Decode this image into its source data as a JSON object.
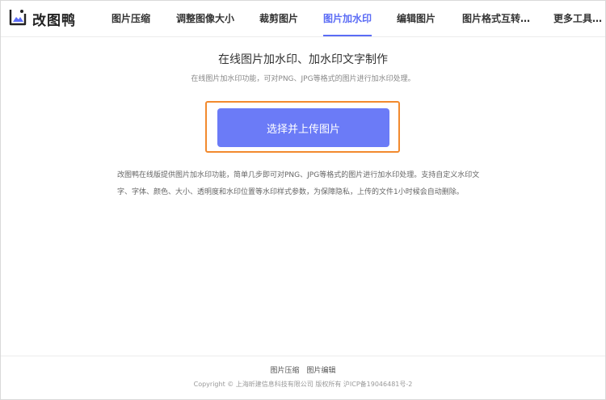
{
  "logo": {
    "text": "改图鸭",
    "icon": "image-frame-icon",
    "accent": "#5b6cf5"
  },
  "nav": {
    "items": [
      {
        "label": "图片压缩"
      },
      {
        "label": "调整图像大小"
      },
      {
        "label": "裁剪图片"
      },
      {
        "label": "图片加水印",
        "active": true
      },
      {
        "label": "编辑图片"
      },
      {
        "label": "图片格式互转…"
      },
      {
        "label": "更多工具…"
      }
    ]
  },
  "main": {
    "title": "在线图片加水印、加水印文字制作",
    "subtitle": "在线图片加水印功能，可对PNG、JPG等格式的图片进行加水印处理。",
    "upload_label": "选择并上传图片",
    "description": "改图鸭在线版提供图片加水印功能，简单几步即可对PNG、JPG等格式的图片进行加水印处理。支持自定义水印文字、字体、颜色、大小、透明度和水印位置等水印样式参数，为保障隐私，上传的文件1小时候会自动删除。"
  },
  "footer": {
    "links": [
      {
        "label": "图片压缩"
      },
      {
        "label": "图片编辑"
      }
    ],
    "copyright": "Copyright © 上海昕建信息科技有限公司 版权所有 沪ICP备19046481号-2"
  },
  "colors": {
    "primary_button": "#6b7bf7",
    "highlight_border": "#f28a2e"
  }
}
